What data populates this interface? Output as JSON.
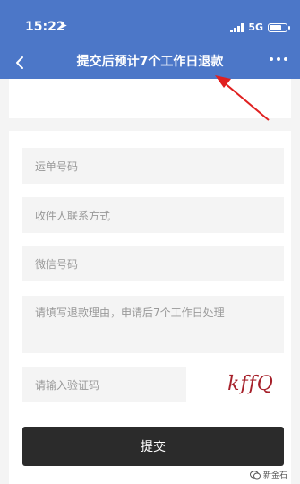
{
  "status_bar": {
    "time": "15:22",
    "network": "5G"
  },
  "nav": {
    "title": "提交后预计7个工作日退款"
  },
  "form": {
    "tracking_number_placeholder": "运单号码",
    "recipient_contact_placeholder": "收件人联系方式",
    "wechat_placeholder": "微信号码",
    "reason_placeholder": "请填写退款理由，申请后7个工作日处理",
    "verification_code_placeholder": "请输入验证码",
    "captcha_text": "kffQ",
    "submit_label": "提交"
  },
  "watermark": {
    "text": "新金石"
  },
  "colors": {
    "header": "#4c77c8",
    "submit_button": "#2b2b2b",
    "field_bg": "#f4f4f4",
    "annotation_arrow": "#e02020",
    "captcha": "#a6202a"
  }
}
